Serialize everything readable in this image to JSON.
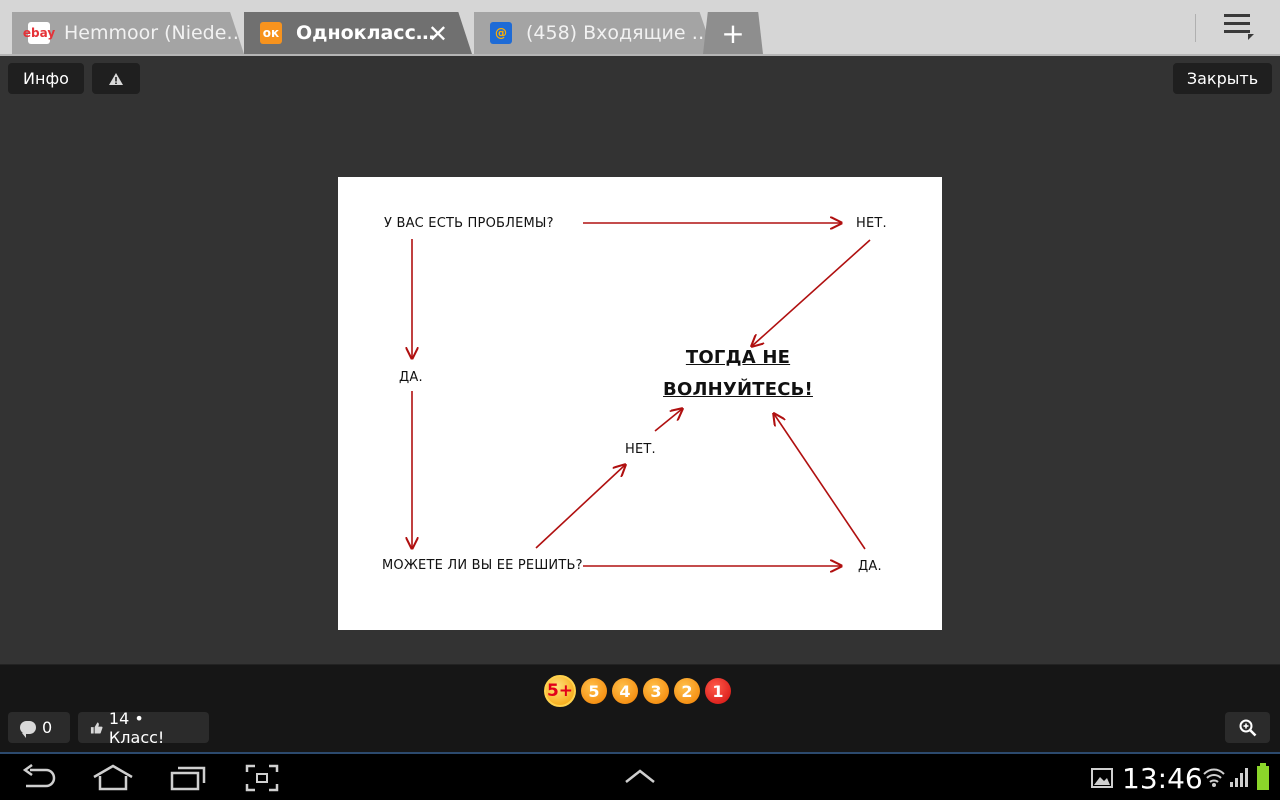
{
  "browser": {
    "tabs": [
      {
        "title": "Hemmoor (Niede…",
        "favicon": "ebay-favicon",
        "active": false
      },
      {
        "title": "Однокласс…",
        "favicon": "odnoklassniki-favicon",
        "active": true
      },
      {
        "title": "(458) Входящие …",
        "favicon": "mail-favicon",
        "active": false
      }
    ],
    "new_tab_label": "+",
    "close_tab_label": "✕",
    "menu_icon": "menu-icon"
  },
  "viewer": {
    "info_label": "Инфо",
    "warning_icon": "warning-icon",
    "close_label": "Закрыть"
  },
  "photo": {
    "q_problems": "У ВАС ЕСТЬ ПРОБЛЕМЫ?",
    "no_top": "НЕТ.",
    "yes_left": "ДА.",
    "center_line1": "ТОГДА НЕ",
    "center_line2": "ВОЛНУЙТЕСЬ!",
    "no_middle": "НЕТ.",
    "q_solve": "МОЖЕТЕ ЛИ ВЫ ЕЕ РЕШИТЬ?",
    "yes_right": "ДА.",
    "arrow_color": "#b01010"
  },
  "bottom": {
    "ratings": [
      "5+",
      "5",
      "4",
      "3",
      "2",
      "1"
    ],
    "comments_count": "0",
    "class_label": "14 • Класс!",
    "zoom_icon": "zoom-in-icon"
  },
  "system": {
    "clock": "13:46",
    "nav_icons": [
      "back-icon",
      "home-icon",
      "recent-apps-icon",
      "screenshot-icon",
      "expand-up-icon"
    ],
    "status_icons": [
      "gallery-icon",
      "wifi-icon",
      "signal-icon",
      "battery-icon"
    ]
  }
}
